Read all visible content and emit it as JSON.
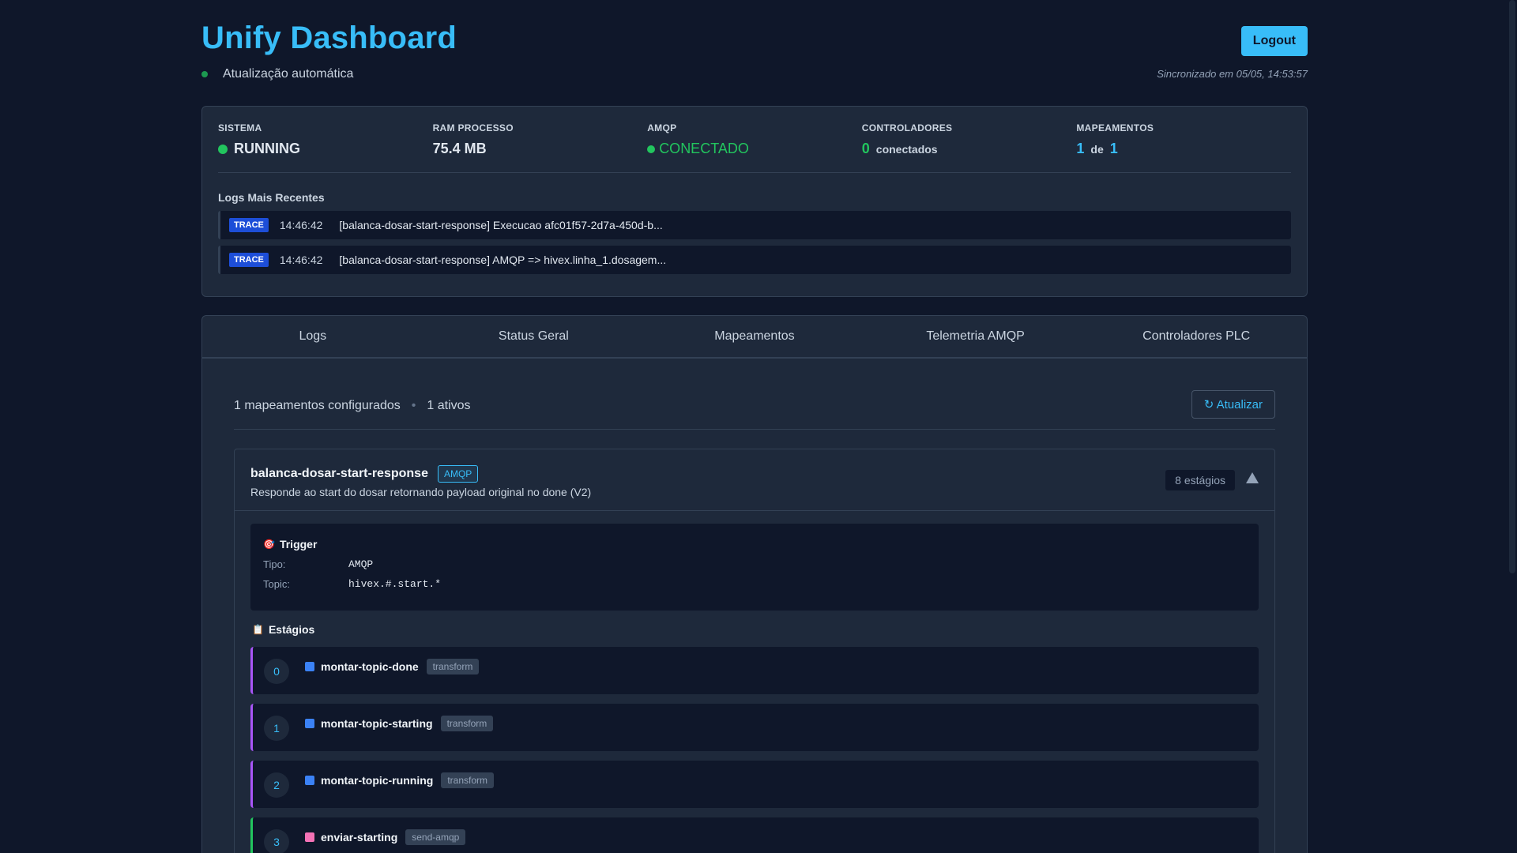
{
  "header": {
    "title": "Unify Dashboard",
    "auto_update": "Atualização automática",
    "logout": "Logout",
    "sync": "Sincronizado em 05/05, 14:53:57"
  },
  "stats": {
    "sistema": {
      "label": "SISTEMA",
      "value": "RUNNING"
    },
    "ram": {
      "label": "RAM PROCESSO",
      "value": "75.4 MB"
    },
    "amqp": {
      "label": "AMQP",
      "value": "CONECTADO"
    },
    "controladores": {
      "label": "CONTROLADORES",
      "count": "0",
      "suffix": "conectados"
    },
    "mapeamentos": {
      "label": "MAPEAMENTOS",
      "active": "1",
      "sep": "de",
      "total": "1"
    }
  },
  "logs": {
    "title": "Logs Mais Recentes",
    "items": [
      {
        "level": "TRACE",
        "time": "14:46:42",
        "message": "[balanca-dosar-start-response] Execucao afc01f57-2d7a-450d-b..."
      },
      {
        "level": "TRACE",
        "time": "14:46:42",
        "message": "[balanca-dosar-start-response] AMQP => hivex.linha_1.dosagem..."
      }
    ]
  },
  "tabs": [
    "Logs",
    "Status Geral",
    "Mapeamentos",
    "Telemetria AMQP",
    "Controladores PLC"
  ],
  "mappings_view": {
    "configured": "1 mapeamentos configurados",
    "separator": "•",
    "active": "1 ativos",
    "refresh": "↻ Atualizar",
    "mapping": {
      "name": "balanca-dosar-start-response",
      "badge": "AMQP",
      "description": "Responde ao start do dosar retornando payload original no done (V2)",
      "stages_count": "8 estágios",
      "trigger": {
        "title": "Trigger",
        "tipo_label": "Tipo:",
        "tipo": "AMQP",
        "topic_label": "Topic:",
        "topic": "hivex.#.start.*"
      },
      "stages_title": "Estágios",
      "stages": [
        {
          "num": "0",
          "name": "montar-topic-done",
          "type": "transform"
        },
        {
          "num": "1",
          "name": "montar-topic-starting",
          "type": "transform"
        },
        {
          "num": "2",
          "name": "montar-topic-running",
          "type": "transform"
        },
        {
          "num": "3",
          "name": "enviar-starting",
          "type": "send-amqp"
        }
      ]
    }
  },
  "colors": {
    "background": "#0f172a",
    "panel": "#1e293b",
    "accent": "#38bdf8",
    "success": "#22c55e",
    "transform_border": "#a855f7"
  }
}
